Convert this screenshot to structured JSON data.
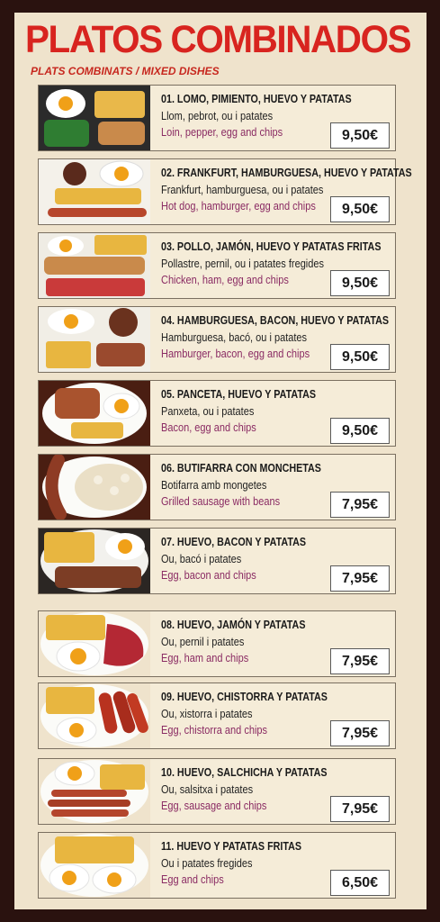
{
  "menu": {
    "title": "PLATOS COMBINADOS",
    "subtitle": "PLATS COMBINATS / MIXED DISHES",
    "dishes": [
      {
        "name": "01. LOMO, PIMIENTO, HUEVO Y PATATAS",
        "catalan": "Llom, pebrot, ou i patates",
        "english": "Loin, pepper, egg and chips",
        "price": "9,50€"
      },
      {
        "name": "02. FRANKFURT, HAMBURGUESA, HUEVO Y PATATAS",
        "catalan": "Frankfurt, hamburguesa, ou i patates",
        "english": "Hot dog, hamburger, egg and chips",
        "price": "9,50€"
      },
      {
        "name": "03. POLLO, JAMÓN, HUEVO Y PATATAS FRITAS",
        "catalan": "Pollastre, pernil, ou i patates fregides",
        "english": "Chicken, ham, egg and chips",
        "price": "9,50€"
      },
      {
        "name": "04. HAMBURGUESA, BACON, HUEVO Y PATATAS",
        "catalan": "Hamburguesa, bacó, ou i patates",
        "english": "Hamburger, bacon, egg and chips",
        "price": "9,50€"
      },
      {
        "name": "05. PANCETA, HUEVO Y PATATAS",
        "catalan": "Panxeta, ou i patates",
        "english": "Bacon, egg and chips",
        "price": "9,50€"
      },
      {
        "name": "06. BUTIFARRA CON MONCHETAS",
        "catalan": "Botifarra amb mongetes",
        "english": "Grilled sausage with beans",
        "price": "7,95€"
      },
      {
        "name": "07. HUEVO, BACON Y PATATAS",
        "catalan": "Ou, bacó i patates",
        "english": "Egg, bacon and chips",
        "price": "7,95€"
      },
      {
        "name": "08. HUEVO, JAMÓN Y PATATAS",
        "catalan": "Ou, pernil i patates",
        "english": "Egg, ham and chips",
        "price": "7,95€"
      },
      {
        "name": "09. HUEVO, CHISTORRA Y PATATAS",
        "catalan": "Ou, xistorra i patates",
        "english": "Egg, chistorra and chips",
        "price": "7,95€"
      },
      {
        "name": "10. HUEVO, SALCHICHA Y PATATAS",
        "catalan": "Ou, salsitxa i patates",
        "english": "Egg, sausage and chips",
        "price": "7,95€"
      },
      {
        "name": "11. HUEVO Y PATATAS FRITAS",
        "catalan": "Ou i patates fregides",
        "english": "Egg and chips",
        "price": "6,50€"
      }
    ]
  },
  "colors": {
    "title": "#d8241f",
    "english_text": "#8a2b63",
    "background": "#efe3cc",
    "border": "#2a120f"
  }
}
